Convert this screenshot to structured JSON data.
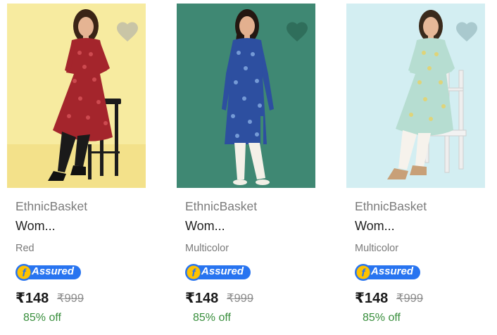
{
  "products": [
    {
      "brand": "EthnicBasket",
      "title": "Wom...",
      "color_label": "Red",
      "assured_label": "Assured",
      "price": "₹148",
      "mrp": "₹999",
      "discount": "85% off",
      "image_bg": "#f7eba0",
      "garment_color": "#a4252c",
      "icons": [
        "wishlist-heart-icon",
        "flipkart-assured-icon"
      ]
    },
    {
      "brand": "EthnicBasket",
      "title": "Wom...",
      "color_label": "Multicolor",
      "assured_label": "Assured",
      "price": "₹148",
      "mrp": "₹999",
      "discount": "85% off",
      "image_bg": "#3f8873",
      "garment_color": "#2d4fa0",
      "icons": [
        "wishlist-heart-icon",
        "flipkart-assured-icon"
      ]
    },
    {
      "brand": "EthnicBasket",
      "title": "Wom...",
      "color_label": "Multicolor",
      "assured_label": "Assured",
      "price": "₹148",
      "mrp": "₹999",
      "discount": "85% off",
      "image_bg": "#d3eef2",
      "garment_color": "#b6ddd1",
      "icons": [
        "wishlist-heart-icon",
        "flipkart-assured-icon"
      ]
    }
  ],
  "colors": {
    "discount_green": "#388e3c",
    "assured_blue": "#2874f0",
    "assured_yellow": "#ffc200",
    "wishlist_heart": "#c2c2c2"
  }
}
